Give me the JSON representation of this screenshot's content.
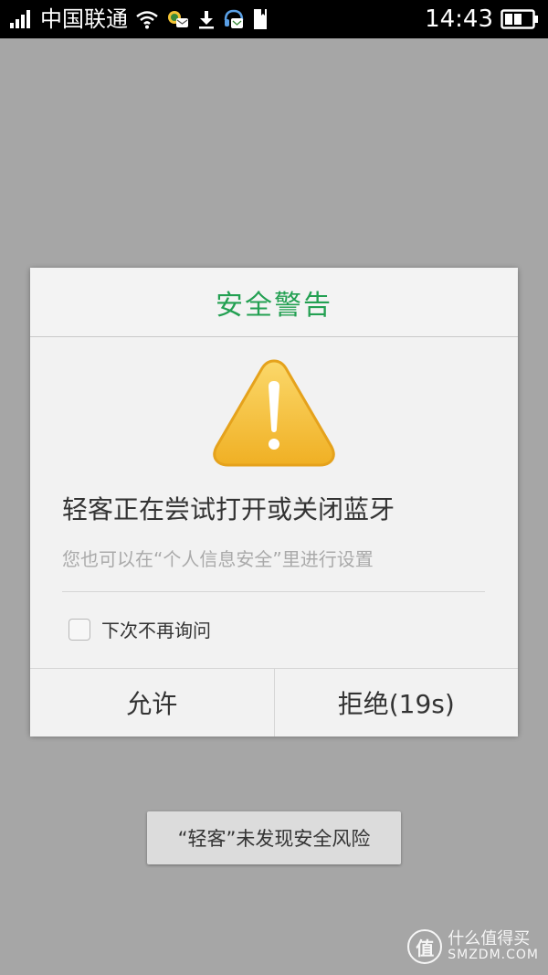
{
  "status_bar": {
    "carrier": "中国联通",
    "time": "14:43",
    "icons": [
      "signal-icon",
      "wifi-icon",
      "chat-notification-icon",
      "download-icon",
      "headset-notification-icon",
      "sd-card-icon",
      "battery-icon"
    ]
  },
  "dialog": {
    "title": "安全警告",
    "message": "轻客正在尝试打开或关闭蓝牙",
    "sub_message": "您也可以在“个人信息安全”里进行设置",
    "checkbox_label": "下次不再询问",
    "checkbox_checked": false,
    "allow_label": "允许",
    "deny_label": "拒绝(19s)",
    "title_color": "#23a052",
    "warning_color": "#f4b92c"
  },
  "toast": {
    "text": "“轻客”未发现安全风险"
  },
  "watermark": {
    "logo": "值",
    "cn": "什么值得买",
    "en": "SMZDM.COM"
  }
}
